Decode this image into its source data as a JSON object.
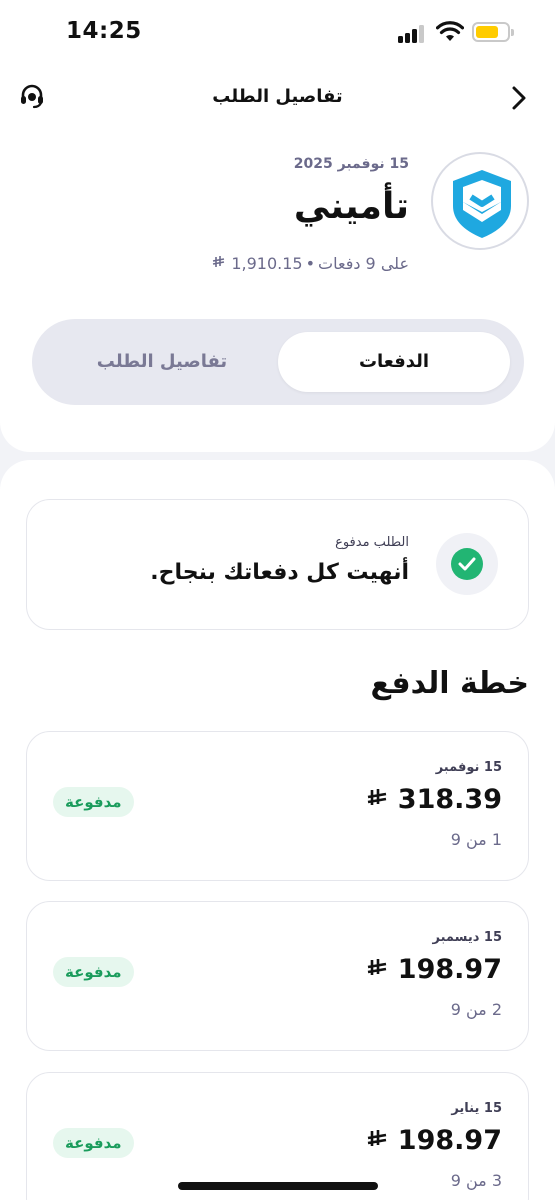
{
  "statusbar": {
    "time": "14:25"
  },
  "header": {
    "title": "تفاصيل الطلب"
  },
  "order": {
    "date": "15 نوفمبر 2025",
    "merchant": "تأميني",
    "installments_text": "على 9 دفعات",
    "total": "1,910.15"
  },
  "tabs": {
    "payments": "الدفعات",
    "details": "تفاصيل الطلب"
  },
  "status": {
    "label": "الطلب مدفوع",
    "message": "أنهيت كل دفعاتك بنجاح."
  },
  "plan": {
    "title": "خطة الدفع",
    "payments": [
      {
        "date": "15 نوفمبر",
        "amount": "318.39",
        "count": "1 من 9",
        "status": "مدفوعة"
      },
      {
        "date": "15 ديسمبر",
        "amount": "198.97",
        "count": "2 من 9",
        "status": "مدفوعة"
      },
      {
        "date": "15 يناير",
        "amount": "198.97",
        "count": "3 من 9",
        "status": "مدفوعة"
      }
    ]
  },
  "colors": {
    "brand": "#1fa8e0",
    "success": "#22b573",
    "badge_bg": "#e6f7ee",
    "badge_text": "#1a9c5c"
  },
  "icons": {
    "back": "chevron-right-icon",
    "support": "headset-icon",
    "status": "check-circle-icon",
    "currency": "riyal-icon"
  }
}
